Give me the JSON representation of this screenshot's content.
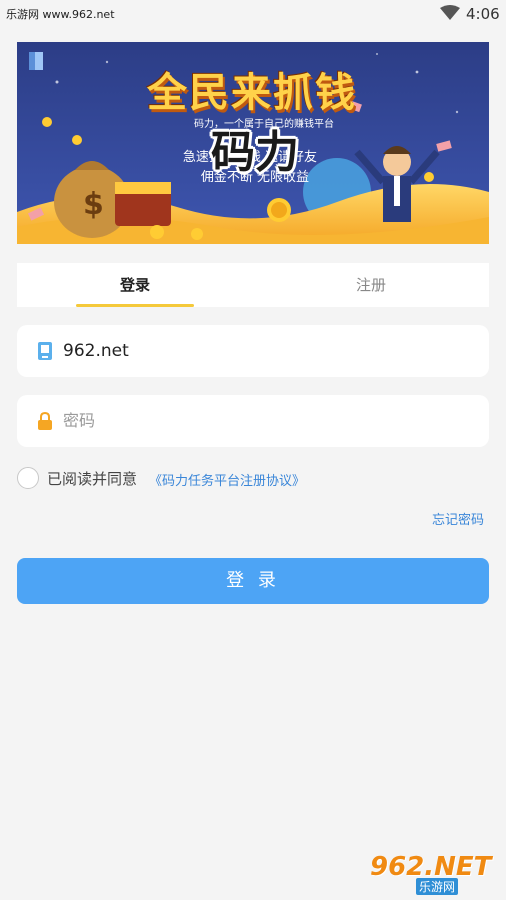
{
  "status_bar": {
    "site_label": "乐游网 www.962.net",
    "time": "4:06"
  },
  "banner": {
    "headline": "全民来抓钱",
    "subtitle": "码力，一个属于自己的赚钱平台",
    "line1": "急速扫码赚钱 邀请好友",
    "line2": "佣金不断 无限收益",
    "overlay_title": "码力"
  },
  "tabs": {
    "login": "登录",
    "register": "注册"
  },
  "form": {
    "account_value": "962.net",
    "password_placeholder": "密码"
  },
  "agreement": {
    "text": "已阅读并同意",
    "link": "《码力任务平台注册协议》"
  },
  "forgot_password": "忘记密码",
  "login_button": "登 录",
  "watermark": {
    "brand": "962.NET",
    "sub": "乐游网"
  },
  "colors": {
    "accent_blue": "#4da4f5",
    "link_blue": "#3a86d8",
    "tab_underline": "#f5c93a"
  },
  "icons": {
    "account": "phone-icon",
    "password": "lock-icon",
    "wifi": "wifi-icon"
  }
}
